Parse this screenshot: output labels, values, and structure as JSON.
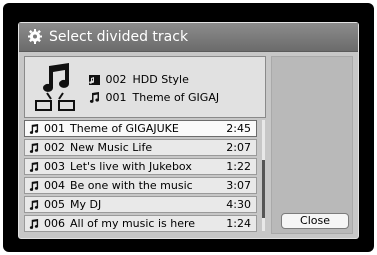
{
  "dialog": {
    "title": "Select divided track"
  },
  "info": {
    "folder_icon": "hdd-folder-icon",
    "track_icon": "music-note-icon",
    "folder_number": "002",
    "folder_name": "HDD Style",
    "track_number": "001",
    "track_name": "Theme of GIGAJ"
  },
  "tracks": [
    {
      "number": "001",
      "title": "Theme of GIGAJUKE",
      "time": "2:45"
    },
    {
      "number": "002",
      "title": "New Music Life",
      "time": "2:07"
    },
    {
      "number": "003",
      "title": "Let's live with Jukebox",
      "time": "1:22"
    },
    {
      "number": "004",
      "title": "Be one with the music",
      "time": "3:07"
    },
    {
      "number": "005",
      "title": "My DJ",
      "time": "4:30"
    },
    {
      "number": "006",
      "title": "All of my music is here",
      "time": "1:24"
    }
  ],
  "buttons": {
    "close_label": "Close"
  },
  "colors": {
    "title_bar": "#7a7a7a",
    "dialog_bg": "#c7c7c7",
    "bezel": "#000000"
  }
}
